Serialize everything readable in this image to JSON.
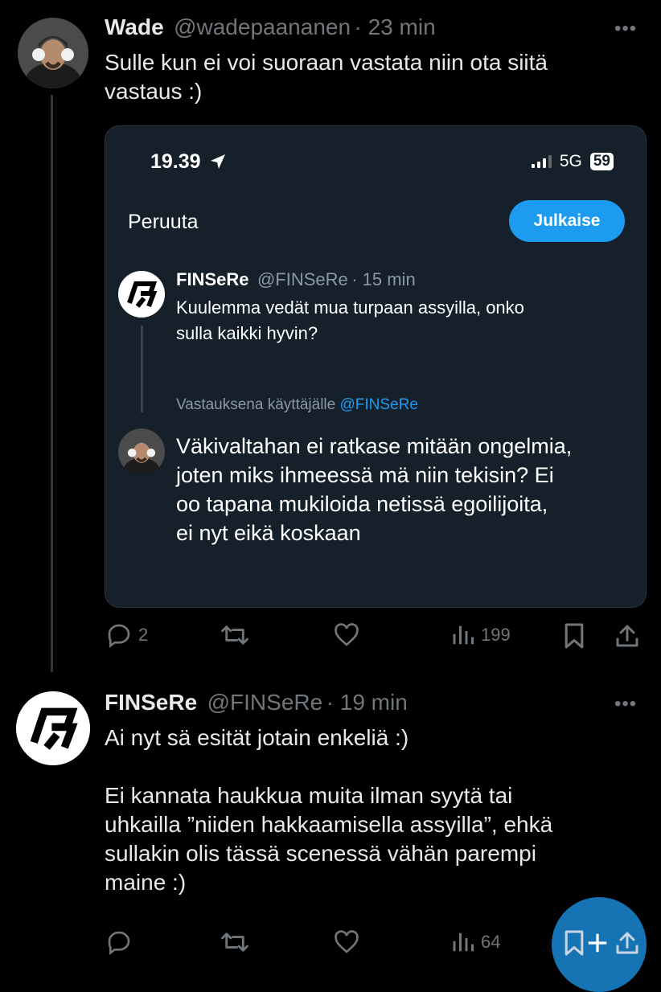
{
  "thread": {
    "tweet1": {
      "name": "Wade",
      "handle": "@wadepaananen",
      "time": "· 23 min",
      "text": "Sulle kun ei voi suoraan vastata niin ota siitä\nvastaus :)",
      "screenshot": {
        "clock": "19.39",
        "network": "5G",
        "battery": "59",
        "cancel_label": "Peruuta",
        "publish_label": "Julkaise",
        "quoted": {
          "name": "FINSeRe",
          "handle": "@FINSeRe",
          "time": "· 15 min",
          "text": "Kuulemma vedät mua turpaan assyilla, onko\nsulla kaikki hyvin?"
        },
        "reply_to_prefix": "Vastauksena käyttäjälle",
        "reply_to_mention": "@FINSeRe",
        "compose_text": "Väkivaltahan ei ratkase mitään ongelmia,\njoten miks ihmeessä mä niin tekisin? Ei\noo tapana mukiloida netissä egoilijoita,\nei nyt eikä koskaan"
      },
      "actions": {
        "replies": "2",
        "views": "199"
      }
    },
    "tweet2": {
      "name": "FINSeRe",
      "handle": "@FINSeRe",
      "time": "· 19 min",
      "text": "Ai nyt sä esität jotain enkeliä :)\n\nEi kannata haukkua muita ilman syytä tai\nuhkailla ”niiden hakkaamisella assyilla”, ehkä\nsullakin olis tässä scenessä vähän parempi\nmaine :)",
      "actions": {
        "views": "64"
      }
    }
  },
  "icons": {
    "reply": "reply-icon",
    "retweet": "retweet-icon",
    "like": "heart-icon",
    "views": "views-icon",
    "bookmark": "bookmark-icon",
    "share": "share-icon",
    "more": "more-icon",
    "compose": "compose-fab-icon"
  },
  "colors": {
    "accent": "#1d9bf0",
    "background": "#000000",
    "card": "#15202b",
    "muted": "#71767b"
  }
}
